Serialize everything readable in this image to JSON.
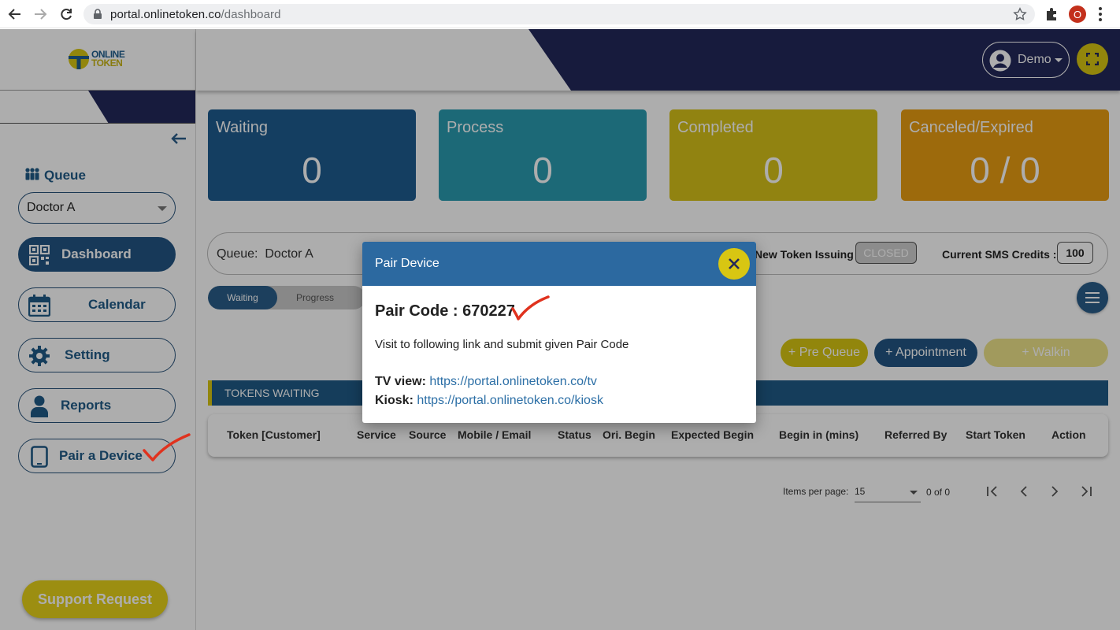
{
  "browser": {
    "url_host": "portal.onlinetoken.co",
    "url_path": "/dashboard",
    "profile_initial": "O"
  },
  "sidebar": {
    "logo_line1": "ONLINE",
    "logo_line2": "TOKEN",
    "queue_label": "Queue",
    "queue_selected": "Doctor A",
    "nav": [
      {
        "label": "Dashboard",
        "icon": "qr-code-icon",
        "active": true
      },
      {
        "label": "Calendar",
        "icon": "calendar-icon",
        "active": false
      },
      {
        "label": "Setting",
        "icon": "gear-icon",
        "active": false
      },
      {
        "label": "Reports",
        "icon": "user-icon",
        "active": false
      },
      {
        "label": "Pair a Device",
        "icon": "tablet-icon",
        "active": false
      }
    ],
    "support_label": "Support Request"
  },
  "header": {
    "user_name": "Demo"
  },
  "stats": [
    {
      "title": "Waiting",
      "value": "0",
      "color": "#1e5c8f"
    },
    {
      "title": "Process",
      "value": "0",
      "color": "#2a9bb0"
    },
    {
      "title": "Completed",
      "value": "0",
      "color": "#d6c21a"
    },
    {
      "title": "Canceled/Expired",
      "value": "0 / 0",
      "color": "#e89c12"
    }
  ],
  "info_bar": {
    "queue_text": "Queue:  Doctor A",
    "new_token_label": "New Token Issuing :",
    "new_token_status": "CLOSED",
    "sms_label": "Current SMS Credits :",
    "sms_value": "100"
  },
  "toggle": {
    "option_a": "Waiting",
    "option_b": "Progress"
  },
  "actions": {
    "pre_queue": "+ Pre Queue",
    "appointment": "+ Appointment",
    "walkin": "+ Walkin"
  },
  "tokens": {
    "section_title": "TOKENS WAITING",
    "columns": [
      "Token [Customer]",
      "Service",
      "Source",
      "Mobile / Email",
      "Status",
      "Ori. Begin",
      "Expected Begin",
      "Begin in (mins)",
      "Referred By",
      "Start Token",
      "Action"
    ]
  },
  "pager": {
    "items_per_page_label": "Items per page:",
    "items_per_page_value": "15",
    "range": "0 of 0"
  },
  "modal": {
    "title": "Pair Device",
    "pair_code_text": "Pair Code : 670227",
    "instruction": "Visit to following link and submit given Pair Code",
    "tv_label": "TV view:",
    "tv_url": "https://portal.onlinetoken.co/tv",
    "kiosk_label": "Kiosk:",
    "kiosk_url": "https://portal.onlinetoken.co/kiosk"
  },
  "colors": {
    "brand_navy": "#23285a",
    "primary_blue": "#235583",
    "accent_yellow": "#d8c612",
    "check_red": "#e0321e"
  }
}
